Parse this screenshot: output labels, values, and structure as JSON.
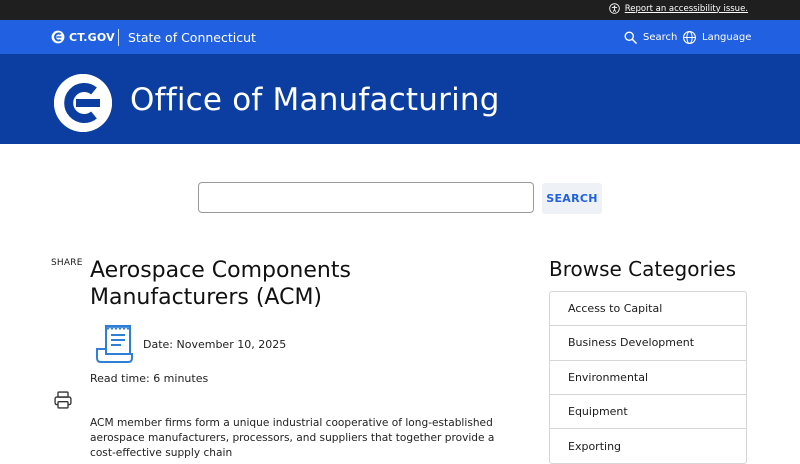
{
  "a11y_bar": {
    "report_link": "Report an accessibility issue."
  },
  "util_bar": {
    "logo_text": "CT.GOV",
    "state_name": "State of Connecticut",
    "search_label": "Search",
    "language_label": "Language"
  },
  "banner": {
    "agency_title": "Office of Manufacturing"
  },
  "search": {
    "input_value": "",
    "button_label": "SEARCH"
  },
  "share": {
    "label": "SHARE"
  },
  "article": {
    "title": "Aerospace Components Manufacturers (ACM)",
    "date_line": "Date: November 10, 2025",
    "read_time": "Read time: 6 minutes",
    "body": "ACM member firms form a unique industrial cooperative of long-established aerospace manufacturers, processors, and suppliers that together provide a cost-effective supply chain"
  },
  "browse": {
    "title": "Browse Categories",
    "items": [
      {
        "label": "Access to Capital"
      },
      {
        "label": "Business Development"
      },
      {
        "label": "Environmental"
      },
      {
        "label": "Equipment"
      },
      {
        "label": "Exporting"
      }
    ]
  },
  "colors": {
    "top_strip": "#1f1f1f",
    "util_bar": "#2160e0",
    "banner": "#0b3ea0",
    "icon_blue": "#2f7fd4"
  },
  "icons": [
    "accessibility-icon",
    "ct-logo-icon",
    "search-icon",
    "globe-icon",
    "ct-seal-icon",
    "printer-icon",
    "document-icon"
  ]
}
